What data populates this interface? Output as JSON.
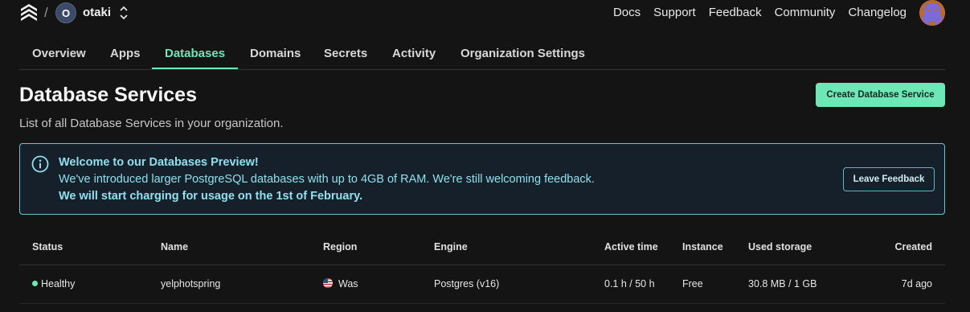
{
  "topbar": {
    "breadcrumb_separator": "/",
    "org_initial": "O",
    "org_name": "otaki",
    "links": [
      "Docs",
      "Support",
      "Feedback",
      "Community",
      "Changelog"
    ]
  },
  "tabs": [
    {
      "label": "Overview",
      "active": false
    },
    {
      "label": "Apps",
      "active": false
    },
    {
      "label": "Databases",
      "active": true
    },
    {
      "label": "Domains",
      "active": false
    },
    {
      "label": "Secrets",
      "active": false
    },
    {
      "label": "Activity",
      "active": false
    },
    {
      "label": "Organization Settings",
      "active": false
    }
  ],
  "header": {
    "title": "Database Services",
    "subtitle": "List of all Database Services in your organization.",
    "create_button": "Create Database Service"
  },
  "banner": {
    "title": "Welcome to our Databases Preview!",
    "body": "We've introduced larger PostgreSQL databases with up to 4GB of RAM. We're still welcoming feedback.",
    "strong": "We will start charging for usage on the 1st of February.",
    "button": "Leave Feedback"
  },
  "table": {
    "columns": {
      "status": "Status",
      "name": "Name",
      "region": "Region",
      "engine": "Engine",
      "active": "Active time",
      "instance": "Instance",
      "storage": "Used storage",
      "created": "Created"
    },
    "rows": [
      {
        "status": "Healthy",
        "name": "yelphotspring",
        "region": "Was",
        "engine": "Postgres (v16)",
        "active": "0.1 h / 50 h",
        "instance": "Free",
        "storage": "30.8 MB / 1 GB",
        "created": "7d ago"
      }
    ]
  },
  "colors": {
    "accent": "#6ee7b7",
    "banner_border": "#67c5d3",
    "banner_text": "#8fe0ec",
    "background": "#141414"
  },
  "icons": {
    "logo": "koyeb-logo-icon",
    "org_switch": "chevron-up-down-icon",
    "info": "info-circle-icon",
    "status_dot": "status-dot-icon",
    "region_flag": "us-flag-icon"
  }
}
